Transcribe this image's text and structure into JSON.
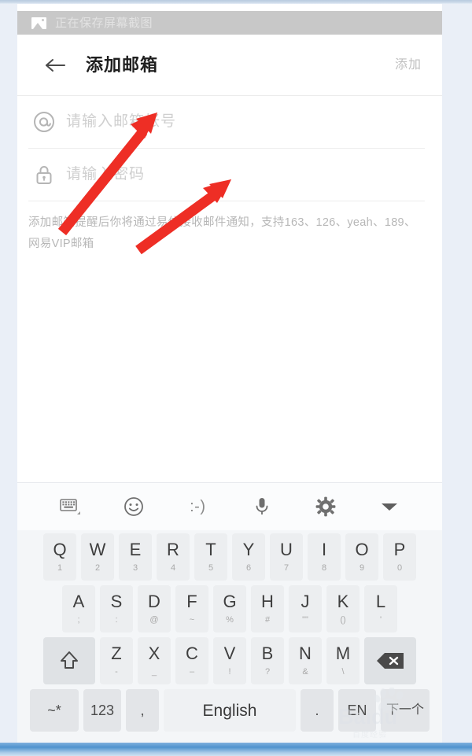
{
  "status_bar": {
    "icon": "image-icon",
    "text": "正在保存屏幕截图"
  },
  "title_bar": {
    "back_icon": "back-arrow-icon",
    "title": "添加邮箱",
    "action_label": "添加"
  },
  "form": {
    "email": {
      "icon": "at-sign-icon",
      "placeholder": "请输入邮箱帐号",
      "value": ""
    },
    "password": {
      "icon": "lock-icon",
      "placeholder": "请输入密码",
      "value": ""
    },
    "hint": "添加邮箱提醒后你将通过易信接收邮件通知，支持163、126、yeah、189、网易VIP邮箱"
  },
  "keyboard": {
    "toolbar": [
      {
        "name": "keyboard-layout-icon",
        "type": "icon",
        "label": ""
      },
      {
        "name": "emoji-icon",
        "type": "icon",
        "label": ""
      },
      {
        "name": "kaomoji-button",
        "type": "text",
        "label": ":-)"
      },
      {
        "name": "microphone-icon",
        "type": "icon",
        "label": ""
      },
      {
        "name": "settings-gear-icon",
        "type": "icon",
        "label": ""
      },
      {
        "name": "collapse-keyboard-icon",
        "type": "icon",
        "label": ""
      }
    ],
    "row1": [
      {
        "main": "Q",
        "sub": "1"
      },
      {
        "main": "W",
        "sub": "2"
      },
      {
        "main": "E",
        "sub": "3"
      },
      {
        "main": "R",
        "sub": "4"
      },
      {
        "main": "T",
        "sub": "5"
      },
      {
        "main": "Y",
        "sub": "6"
      },
      {
        "main": "U",
        "sub": "7"
      },
      {
        "main": "I",
        "sub": "8"
      },
      {
        "main": "O",
        "sub": "9"
      },
      {
        "main": "P",
        "sub": "0"
      }
    ],
    "row2": [
      {
        "main": "A",
        "sub": ";"
      },
      {
        "main": "S",
        "sub": ":"
      },
      {
        "main": "D",
        "sub": "@"
      },
      {
        "main": "F",
        "sub": "~"
      },
      {
        "main": "G",
        "sub": "%"
      },
      {
        "main": "H",
        "sub": "#"
      },
      {
        "main": "J",
        "sub": "\"\""
      },
      {
        "main": "K",
        "sub": "()"
      },
      {
        "main": "L",
        "sub": "'"
      }
    ],
    "row3": [
      {
        "main": "Z",
        "sub": "-"
      },
      {
        "main": "X",
        "sub": "_"
      },
      {
        "main": "C",
        "sub": "–"
      },
      {
        "main": "V",
        "sub": "!"
      },
      {
        "main": "B",
        "sub": "?"
      },
      {
        "main": "N",
        "sub": "&"
      },
      {
        "main": "M",
        "sub": "\\"
      }
    ],
    "shift_key": "shift-icon",
    "backspace_key": "backspace-icon",
    "row4": {
      "symbols": "~*",
      "numbers": "123",
      "comma": ",",
      "space": "English",
      "period": ".",
      "language": "EN",
      "next": "下一个"
    }
  },
  "annotations": {
    "arrow_color": "#ee2e25",
    "arrow_count": 2,
    "arrow_1_target": "email-field",
    "arrow_2_target": "password-field"
  },
  "watermark": {
    "brand": "Baidu",
    "sub": "百度经验"
  }
}
